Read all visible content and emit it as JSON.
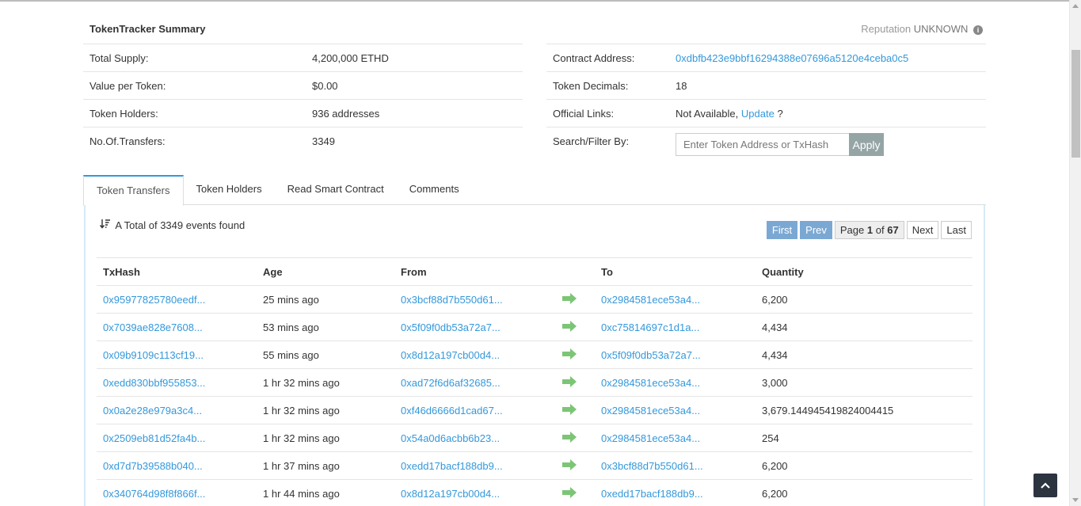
{
  "summary": {
    "title": "TokenTracker Summary",
    "reputation_label": "Reputation",
    "reputation_value": "UNKNOWN",
    "left": [
      {
        "label": "Total Supply:",
        "value": "4,200,000 ETHD"
      },
      {
        "label": "Value per Token:",
        "value": "$0.00"
      },
      {
        "label": "Token Holders:",
        "value": "936 addresses"
      },
      {
        "label": "No.Of.Transfers:",
        "value": "3349"
      }
    ],
    "contract_label": "Contract Address:",
    "contract_address": "0xdbfb423e9bbf16294388e07696a5120e4ceba0c5",
    "decimals_label": "Token Decimals:",
    "decimals_value": "18",
    "links_label": "Official Links:",
    "links_value": "Not Available,",
    "links_update": "Update",
    "links_suffix": "?",
    "search_label": "Search/Filter By:",
    "search_placeholder": "Enter Token Address or TxHash",
    "apply_label": "Apply"
  },
  "tabs": [
    "Token Transfers",
    "Token Holders",
    "Read Smart Contract",
    "Comments"
  ],
  "total_text": "A Total of 3349 events found",
  "pager": {
    "first": "First",
    "prev": "Prev",
    "page_prefix": "Page",
    "page_current": "1",
    "page_of": "of",
    "page_total": "67",
    "next": "Next",
    "last": "Last"
  },
  "table": {
    "headers": [
      "TxHash",
      "Age",
      "From",
      "",
      "To",
      "Quantity"
    ],
    "rows": [
      {
        "tx": "0x95977825780eedf...",
        "age": "25 mins ago",
        "from": "0x3bcf88d7b550d61...",
        "to": "0x2984581ece53a4...",
        "qty": "6,200"
      },
      {
        "tx": "0x7039ae828e7608...",
        "age": "53 mins ago",
        "from": "0x5f09f0db53a72a7...",
        "to": "0xc75814697c1d1a...",
        "qty": "4,434"
      },
      {
        "tx": "0x09b9109c113cf19...",
        "age": "55 mins ago",
        "from": "0x8d12a197cb00d4...",
        "to": "0x5f09f0db53a72a7...",
        "qty": "4,434"
      },
      {
        "tx": "0xedd830bbf955853...",
        "age": "1 hr 32 mins ago",
        "from": "0xad72f6d6af32685...",
        "to": "0x2984581ece53a4...",
        "qty": "3,000"
      },
      {
        "tx": "0x0a2e28e979a3c4...",
        "age": "1 hr 32 mins ago",
        "from": "0xf46d6666d1cad67...",
        "to": "0x2984581ece53a4...",
        "qty": "3,679.144945419824004415"
      },
      {
        "tx": "0x2509eb81d52fa4b...",
        "age": "1 hr 32 mins ago",
        "from": "0x54a0d6acbb6b23...",
        "to": "0x2984581ece53a4...",
        "qty": "254"
      },
      {
        "tx": "0xd7d7b39588b040...",
        "age": "1 hr 37 mins ago",
        "from": "0xedd17bacf188db9...",
        "to": "0x3bcf88d7b550d61...",
        "qty": "6,200"
      },
      {
        "tx": "0x340764d98f8f866f...",
        "age": "1 hr 44 mins ago",
        "from": "0x8d12a197cb00d4...",
        "to": "0xedd17bacf188db9...",
        "qty": "6,200"
      }
    ]
  },
  "colors": {
    "link": "#3498db",
    "arrow": "#7cc576",
    "apply": "#95a5a6",
    "pager_active": "#7ba8d3"
  },
  "icons": [
    "info-icon",
    "sort-icon",
    "arrow-right-icon",
    "chevron-up-icon"
  ]
}
